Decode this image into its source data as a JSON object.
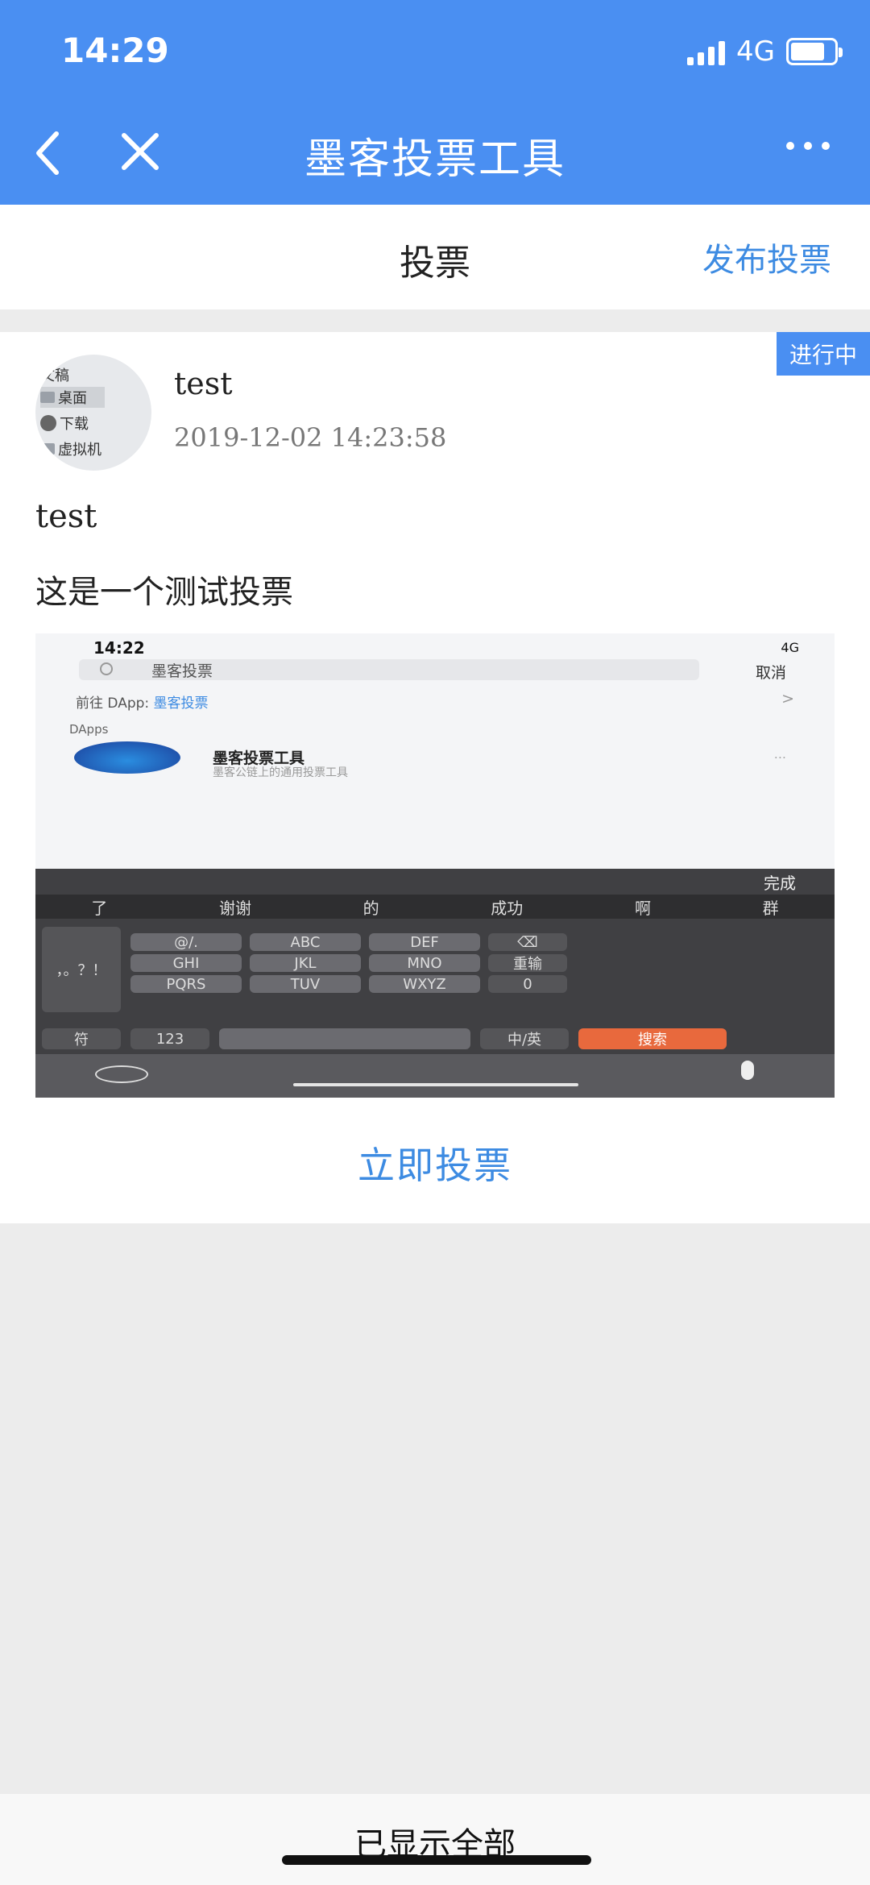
{
  "status_bar": {
    "time": "14:29",
    "network": "4G"
  },
  "nav": {
    "title": "墨客投票工具"
  },
  "header": {
    "title": "投票",
    "publish_label": "发布投票"
  },
  "card": {
    "status_badge": "进行中",
    "avatar_items": [
      "文稿",
      "桌面",
      "下载",
      "虚拟机"
    ],
    "user_name": "test",
    "timestamp": "2019-12-02 14:23:58",
    "vote_title": "test",
    "vote_description": "这是一个测试投票",
    "vote_button": "立即投票"
  },
  "embedded_screenshot": {
    "time": "14:22",
    "status": "4G",
    "search_text": "墨客投票",
    "cancel_label": "取消",
    "goto_prefix": "前往 DApp:",
    "goto_link": "墨客投票",
    "section_label": "DApps",
    "app_title": "墨客投票工具",
    "app_desc": "墨客公链上的通用投票工具",
    "app_more": "...",
    "keyboard_done": "完成",
    "suggestions": [
      "了",
      "谢谢",
      "的",
      "成功",
      "啊",
      "群"
    ],
    "keys": {
      "punct": "@/.",
      "abc": "ABC",
      "def": "DEF",
      "ghi": "GHI",
      "jkl": "JKL",
      "mno": "MNO",
      "pqrs": "PQRS",
      "tuv": "TUV",
      "wxyz": "WXYZ",
      "reenter": "重输",
      "zero": "0",
      "symbols": "符",
      "num": "123",
      "lang": "中/英",
      "search": "搜索"
    }
  },
  "footer": {
    "text": "已显示全部"
  }
}
